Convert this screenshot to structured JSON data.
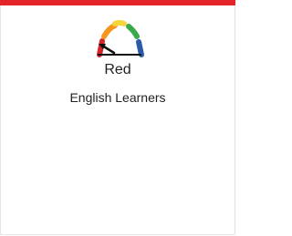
{
  "indicator": {
    "level": "Red",
    "group": "English Learners",
    "gauge_icon": "performance-gauge-icon",
    "gauge_colors": [
      "#d7262b",
      "#f7941d",
      "#f6d53c",
      "#3aa94a",
      "#2a5aa8"
    ],
    "needle_color": "#111111",
    "accent_color": "#e5232b"
  }
}
